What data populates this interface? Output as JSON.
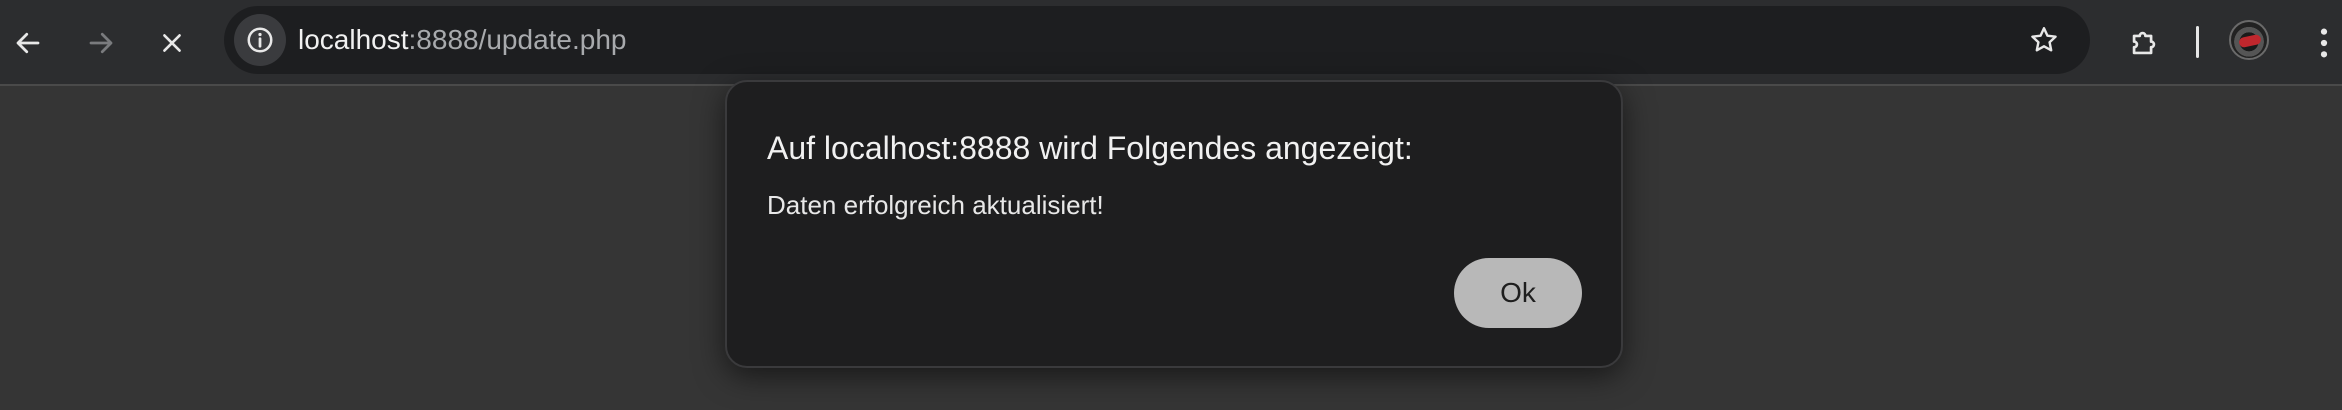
{
  "browser": {
    "url": {
      "host": "localhost",
      "rest": ":8888/update.php"
    },
    "icons": {
      "back": "arrow-left-icon",
      "forward": "arrow-right-icon",
      "stop": "close-icon",
      "site_info": "info-icon",
      "bookmark": "star-icon",
      "extensions": "puzzle-icon",
      "more": "vertical-dots-icon"
    }
  },
  "dialog": {
    "title": "Auf localhost:8888 wird Folgendes angezeigt:",
    "message": "Daten erfolgreich aktualisiert!",
    "ok_label": "Ok"
  },
  "colors": {
    "page_background": "#353535",
    "toolbar": "#2c2d2f",
    "omnibox": "#1d1e20",
    "dialog": "#1e1e1f",
    "ok_button": "#b8b8b8"
  }
}
